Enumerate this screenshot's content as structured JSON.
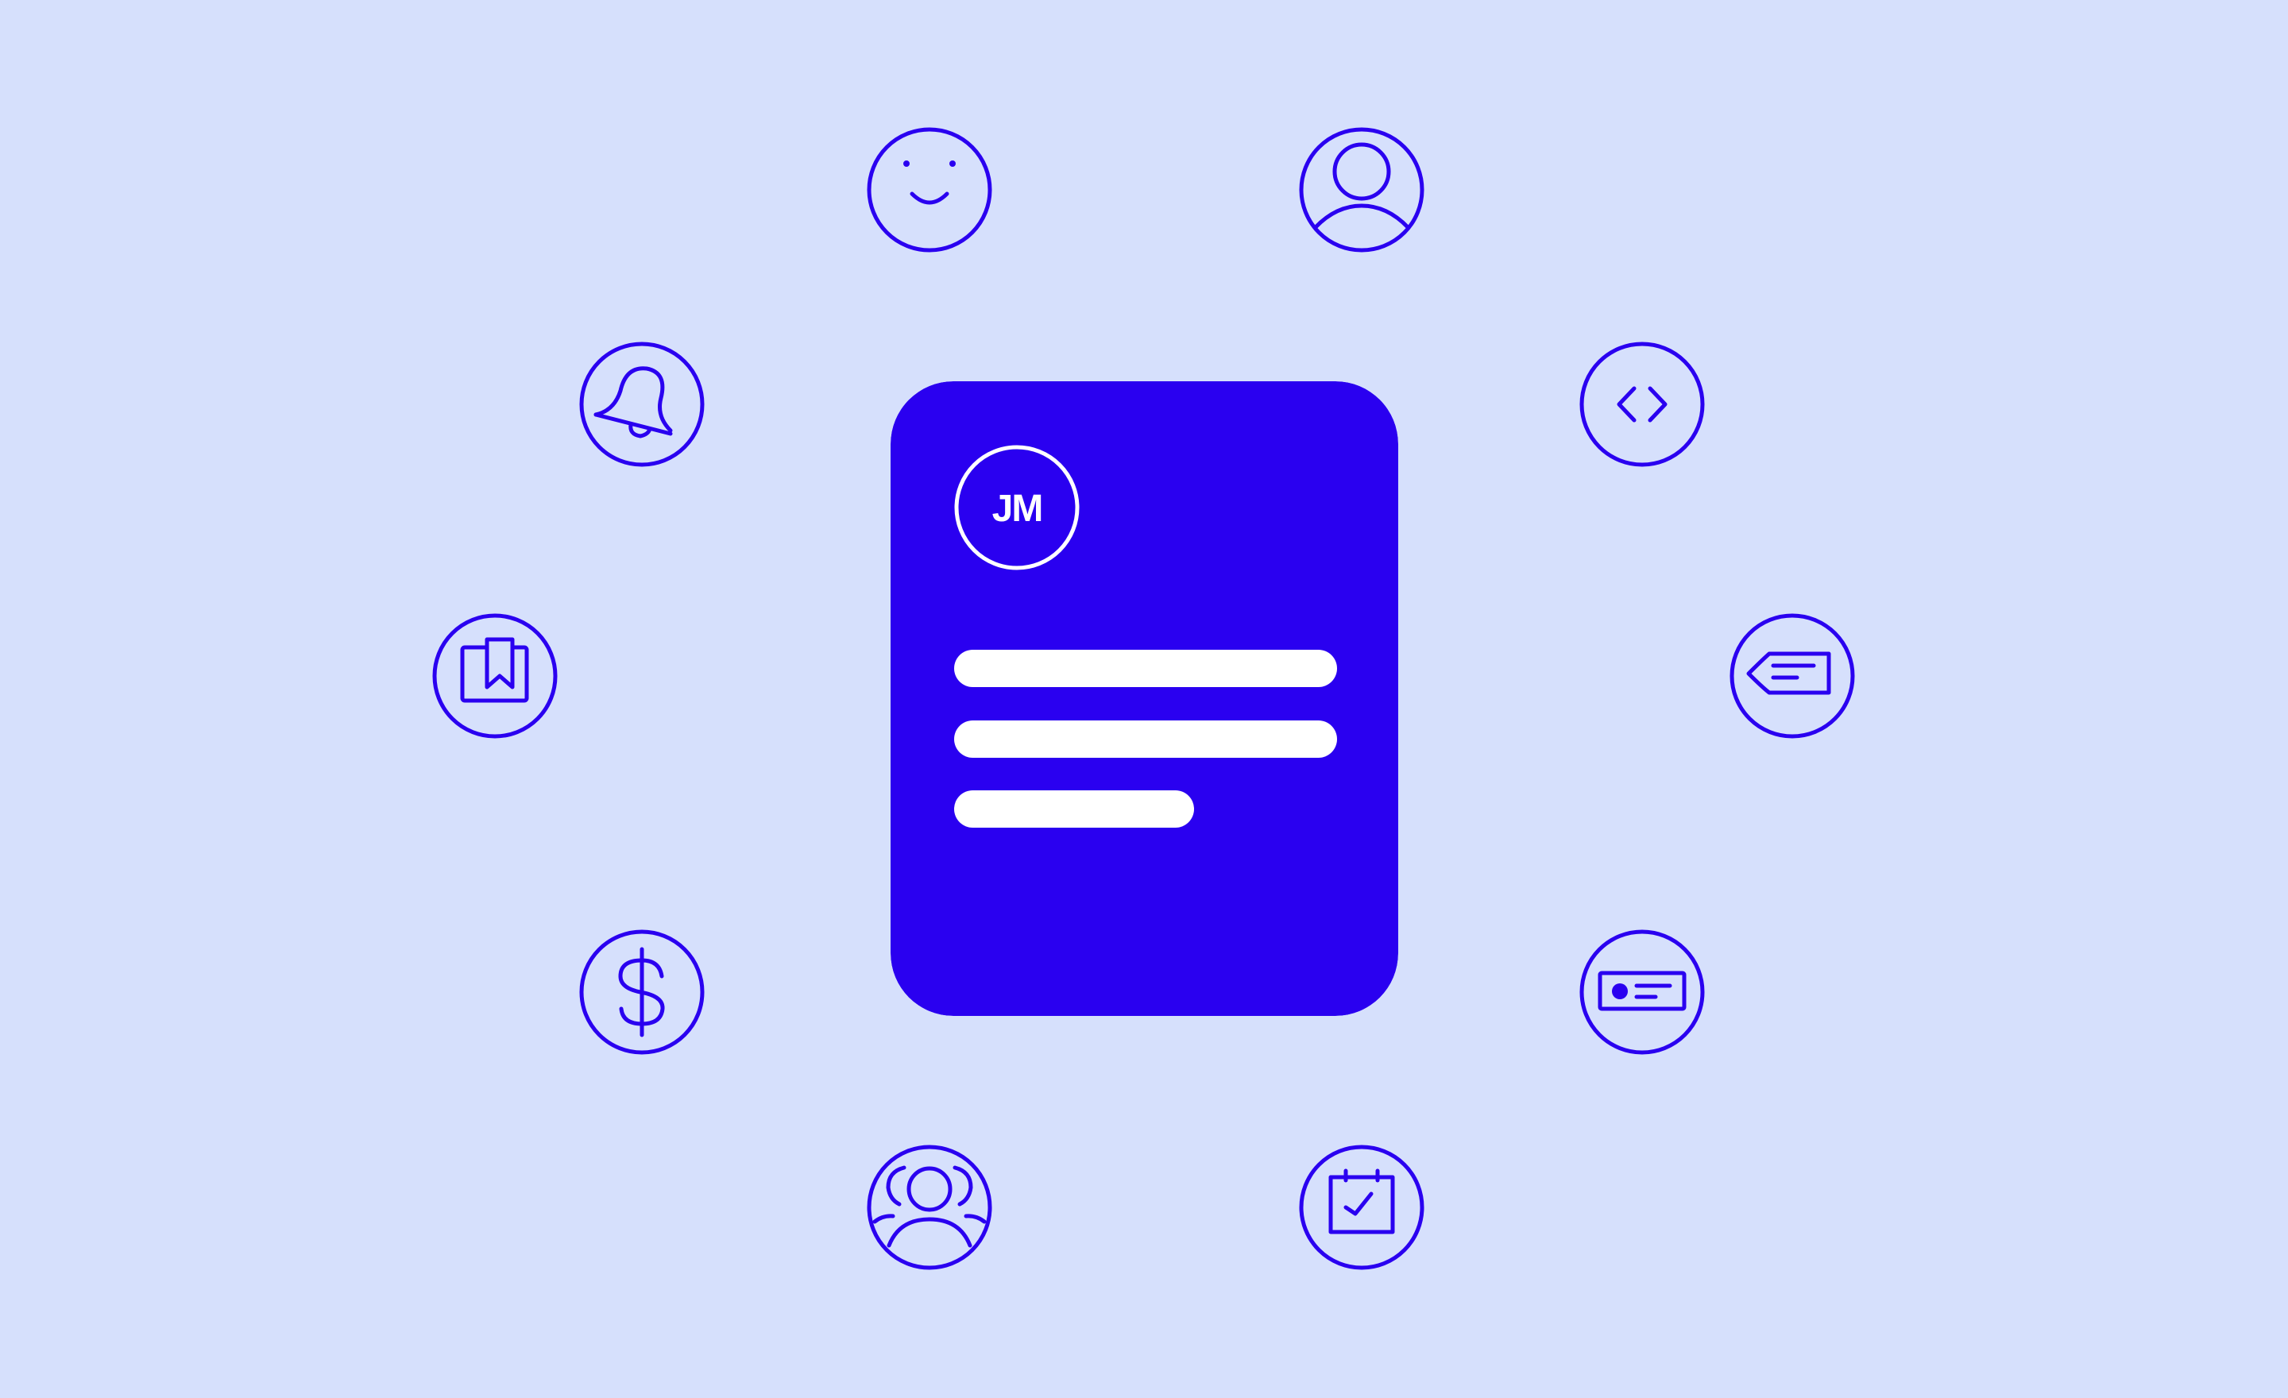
{
  "colors": {
    "background": "#d6e0fc",
    "accent": "#2a00f0",
    "card_fill": "#2a00f0",
    "card_text": "#ffffff"
  },
  "card": {
    "monogram": "JM",
    "content_lines": 3
  },
  "icons": [
    "smiley-icon",
    "user-profile-icon",
    "bell-icon",
    "code-icon",
    "bookmark-box-icon",
    "tag-icon",
    "dollar-icon",
    "id-card-icon",
    "team-icon",
    "calendar-check-icon"
  ]
}
